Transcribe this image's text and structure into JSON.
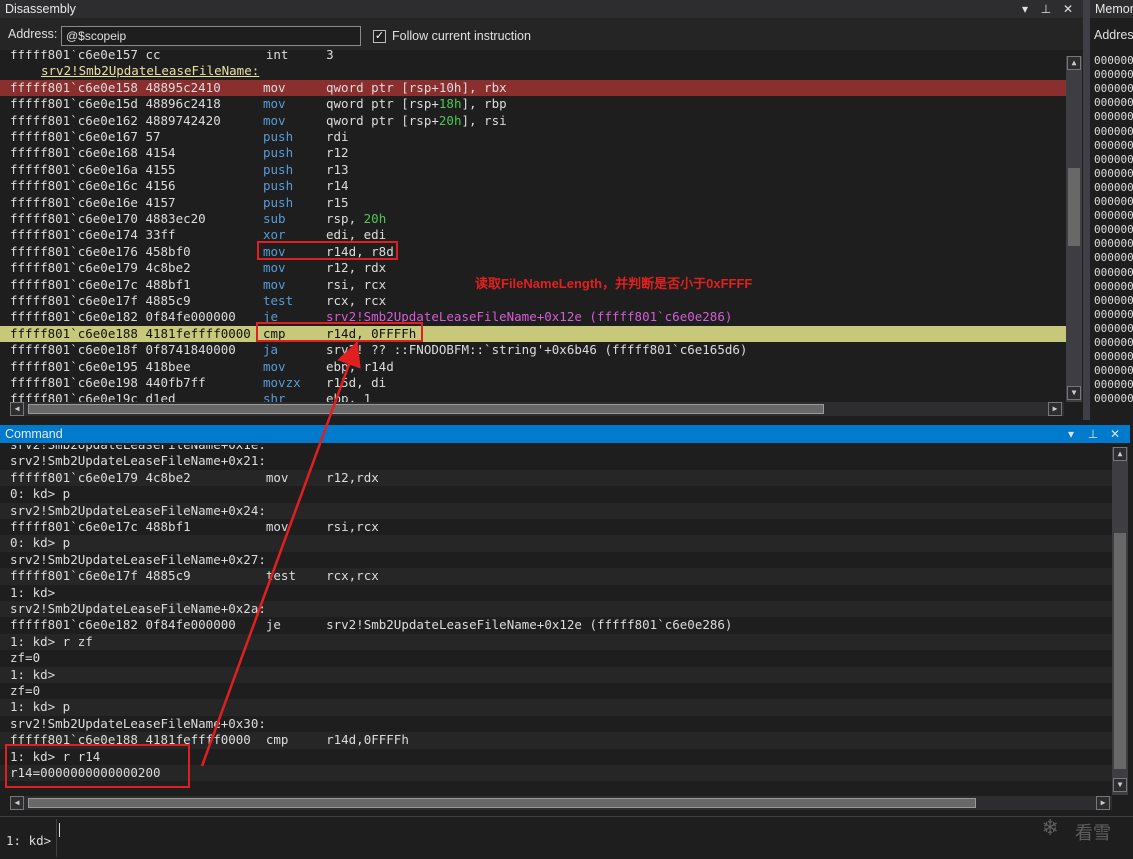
{
  "disassembly": {
    "title": "Disassembly",
    "address_label": "Address:",
    "address_value": "@$scopeip",
    "follow_label": "Follow current instruction",
    "follow_checked": true,
    "partial_top": "fffff801`c6e0e157 cc              int     3",
    "function_label": "srv2!Smb2UpdateLeaseFileName:",
    "rows": [
      {
        "addr": "fffff801`c6e0e158 48895c2410",
        "mn": "mov",
        "op": "qword ptr [rsp+10h], rbx",
        "hl": "bp"
      },
      {
        "addr": "fffff801`c6e0e15d 48896c2418",
        "mn": "mov",
        "op_pre": "qword ptr [rsp+",
        "op_hex": "18h",
        "op_post": "], rbp"
      },
      {
        "addr": "fffff801`c6e0e162 4889742420",
        "mn": "mov",
        "op_pre": "qword ptr [rsp+",
        "op_hex": "20h",
        "op_post": "], rsi"
      },
      {
        "addr": "fffff801`c6e0e167 57",
        "mn": "push",
        "op": "rdi"
      },
      {
        "addr": "fffff801`c6e0e168 4154",
        "mn": "push",
        "op": "r12"
      },
      {
        "addr": "fffff801`c6e0e16a 4155",
        "mn": "push",
        "op": "r13"
      },
      {
        "addr": "fffff801`c6e0e16c 4156",
        "mn": "push",
        "op": "r14"
      },
      {
        "addr": "fffff801`c6e0e16e 4157",
        "mn": "push",
        "op": "r15"
      },
      {
        "addr": "fffff801`c6e0e170 4883ec20",
        "mn": "sub",
        "op_pre": "rsp, ",
        "op_hex": "20h",
        "op_post": ""
      },
      {
        "addr": "fffff801`c6e0e174 33ff",
        "mn": "xor",
        "op": "edi, edi"
      },
      {
        "addr": "fffff801`c6e0e176 458bf0",
        "mn": "mov",
        "op": "r14d, r8d"
      },
      {
        "addr": "fffff801`c6e0e179 4c8be2",
        "mn": "mov",
        "op": "r12, rdx"
      },
      {
        "addr": "fffff801`c6e0e17c 488bf1",
        "mn": "mov",
        "op": "rsi, rcx"
      },
      {
        "addr": "fffff801`c6e0e17f 4885c9",
        "mn": "test",
        "op": "rcx, rcx"
      },
      {
        "addr": "fffff801`c6e0e182 0f84fe000000",
        "mn": "je",
        "op": "srv2!Smb2UpdateLeaseFileName+0x12e (fffff801`c6e0e286)",
        "mag": true
      },
      {
        "addr": "fffff801`c6e0e188 4181feffff0000",
        "mn": "cmp",
        "op": "r14d, 0FFFFh",
        "hl": "cur"
      },
      {
        "addr": "fffff801`c6e0e18f 0f8741840000",
        "mn": "ja",
        "op": "srv2! ?? ::FNODOBFM::`string'+0x6b46 (fffff801`c6e165d6)"
      },
      {
        "addr": "fffff801`c6e0e195 418bee",
        "mn": "mov",
        "op": "ebp, r14d"
      },
      {
        "addr": "fffff801`c6e0e198 440fb7ff",
        "mn": "movzx",
        "op": "r15d, di"
      },
      {
        "addr": "fffff801`c6e0e19c d1ed",
        "mn": "shr",
        "op": "ebp, 1"
      }
    ]
  },
  "annotation": "读取FileNameLength，并判断是否小于0xFFFF",
  "memory": {
    "title": "Memor",
    "address_label": "Addres",
    "values": [
      "0000000",
      "0000000",
      "0000000",
      "0000000",
      "0000000",
      "0000000",
      "0000000",
      "0000000",
      "0000000",
      "0000000",
      "0000000",
      "0000000",
      "0000000",
      "0000000",
      "0000000",
      "0000000",
      "0000000",
      "0000000",
      "0000000",
      "0000000",
      "0000000",
      "0000000",
      "0000000",
      "0000000",
      "0000000"
    ]
  },
  "command": {
    "title": "Command",
    "partial_top": "srv2!Smb2UpdateLeaseFileName+0x1e:",
    "lines": [
      "srv2!Smb2UpdateLeaseFileName+0x21:",
      "fffff801`c6e0e179 4c8be2          mov     r12,rdx",
      "0: kd> p",
      "srv2!Smb2UpdateLeaseFileName+0x24:",
      "fffff801`c6e0e17c 488bf1          mov     rsi,rcx",
      "0: kd> p",
      "srv2!Smb2UpdateLeaseFileName+0x27:",
      "fffff801`c6e0e17f 4885c9          test    rcx,rcx",
      "1: kd>",
      "srv2!Smb2UpdateLeaseFileName+0x2a:",
      "fffff801`c6e0e182 0f84fe000000    je      srv2!Smb2UpdateLeaseFileName+0x12e (fffff801`c6e0e286)",
      "1: kd> r zf",
      "zf=0",
      "1: kd>",
      "zf=0",
      "1: kd> p",
      "srv2!Smb2UpdateLeaseFileName+0x30:",
      "fffff801`c6e0e188 4181feffff0000  cmp     r14d,0FFFFh",
      "1: kd> r r14",
      "r14=0000000000000200"
    ],
    "prompt": "1: kd>"
  },
  "watermark": "看雪",
  "colors": {
    "breakpoint_row": "#8b2e2e",
    "current_row": "#c8c87a",
    "annotation": "#e02020",
    "title_active": "#007acc"
  }
}
